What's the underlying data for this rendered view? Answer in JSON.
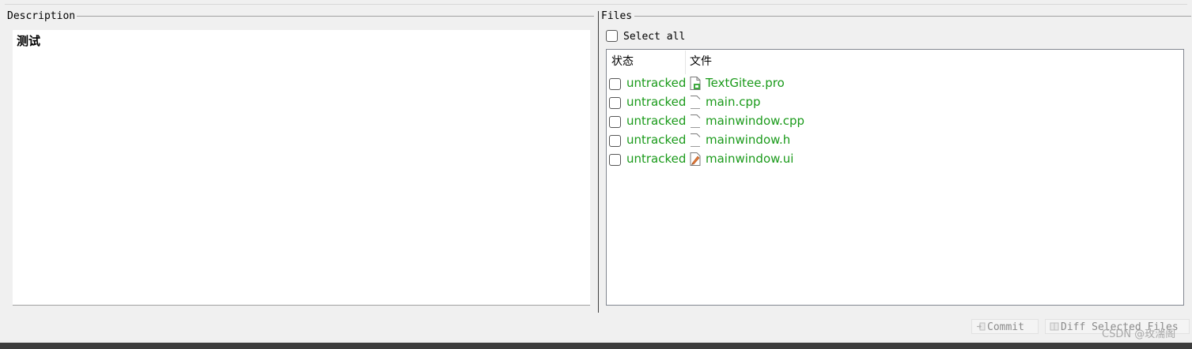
{
  "description": {
    "title": "Description",
    "text": "测试"
  },
  "files": {
    "title": "Files",
    "select_all_label": "Select all",
    "columns": [
      "状态",
      "文件"
    ],
    "rows": [
      {
        "status": "untracked",
        "name": "TextGitee.pro",
        "icon": "project-file-icon"
      },
      {
        "status": "untracked",
        "name": "main.cpp",
        "icon": "text-file-icon"
      },
      {
        "status": "untracked",
        "name": "mainwindow.cpp",
        "icon": "text-file-icon"
      },
      {
        "status": "untracked",
        "name": "mainwindow.h",
        "icon": "text-file-icon"
      },
      {
        "status": "untracked",
        "name": "mainwindow.ui",
        "icon": "ui-form-file-icon"
      }
    ]
  },
  "buttons": {
    "commit_label": "Commit",
    "diff_label": "Diff Selected Files"
  },
  "watermark": "CSDN @玫湍阁",
  "colors": {
    "untracked_text": "#1a9a1a",
    "disabled_text": "#8a8a8a"
  }
}
